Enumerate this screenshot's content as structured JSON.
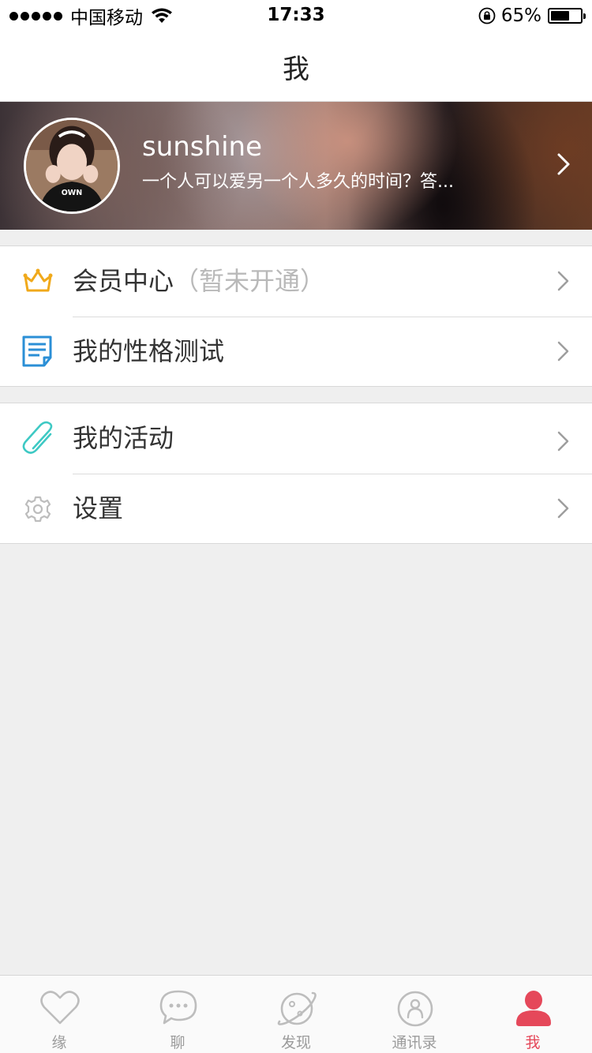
{
  "status_bar": {
    "carrier": "中国移动",
    "time": "17:33",
    "battery_percent": "65%",
    "battery_level": 0.65
  },
  "nav": {
    "title": "我"
  },
  "profile": {
    "name": "sunshine",
    "motto": "一个人可以爱另一个人多久的时间？答..."
  },
  "menu": {
    "member_center": {
      "label": "会员中心",
      "status": "（暂未开通）",
      "icon": "crown-icon",
      "color": "#f0a91b"
    },
    "personality_test": {
      "label": "我的性格测试",
      "icon": "note-icon",
      "color": "#2b8fd6"
    },
    "my_activities": {
      "label": "我的活动",
      "icon": "paperclip-icon",
      "color": "#3ec9c4"
    },
    "settings": {
      "label": "设置",
      "icon": "gear-icon",
      "color": "#bdbdbd"
    }
  },
  "tabs": [
    {
      "label": "缘",
      "icon": "heart-icon",
      "active": false
    },
    {
      "label": "聊",
      "icon": "chat-bubble-icon",
      "active": false
    },
    {
      "label": "发现",
      "icon": "planet-icon",
      "active": false
    },
    {
      "label": "通讯录",
      "icon": "contact-icon",
      "active": false
    },
    {
      "label": "我",
      "icon": "person-icon",
      "active": true
    }
  ],
  "colors": {
    "accent": "#e5485a",
    "tab_inactive": "#9b9b9b"
  }
}
